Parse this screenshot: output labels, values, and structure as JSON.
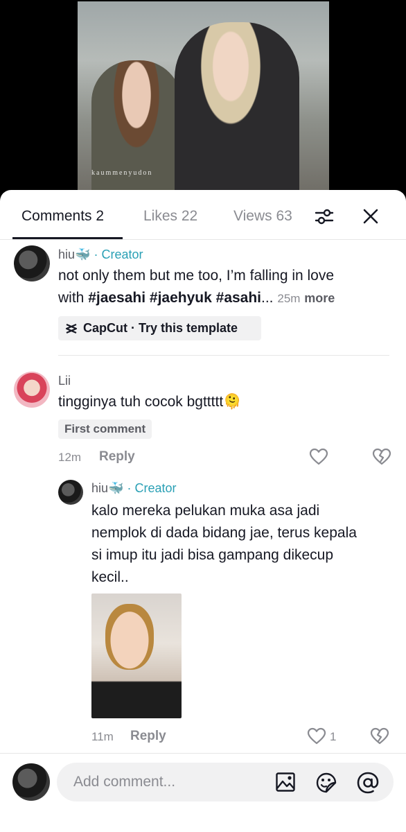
{
  "video": {
    "watermark": "kaummenyudon"
  },
  "tabs": {
    "comments": "Comments 2",
    "likes": "Likes 22",
    "views": "Views 63"
  },
  "post": {
    "author": "hiu🐳",
    "creator_label": "· Creator",
    "text_line1": "not only them but me too, I’m falling in love",
    "text_line2_prefix": "with ",
    "hashtags": "#jaesahi #jaehyuk #asahi",
    "ellipsis": "...",
    "time": "25m",
    "more_label": "more",
    "template_label": "CapCut · Try this template"
  },
  "comments": [
    {
      "author": "Lii",
      "text": "tingginya tuh cocok bgttttt🫠",
      "badge": "First comment",
      "time": "12m",
      "reply_label": "Reply"
    }
  ],
  "reply": {
    "author": "hiu🐳",
    "creator_label": "· Creator",
    "text_line1": "kalo mereka pelukan muka asa jadi",
    "text_line2": "nemplok di dada bidang jae, terus kepala",
    "text_line3": "si imup itu jadi bisa gampang dikecup",
    "text_line4": "kecil..",
    "time": "11m",
    "reply_label": "Reply",
    "like_count": "1"
  },
  "composer": {
    "placeholder": "Add comment..."
  }
}
